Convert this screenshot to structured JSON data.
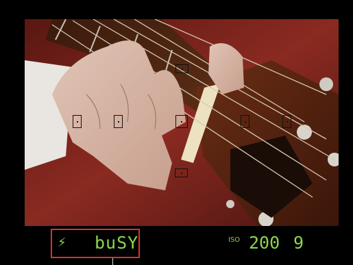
{
  "viewfinder": {
    "flash_icon": "flash-ready-icon",
    "status_text": "buSY",
    "iso_label": "ISO",
    "iso_value": "200",
    "shots_remaining": "9",
    "display_color": "#8cd64a",
    "callout_color": "#d9342b",
    "af_points_count": 9
  }
}
